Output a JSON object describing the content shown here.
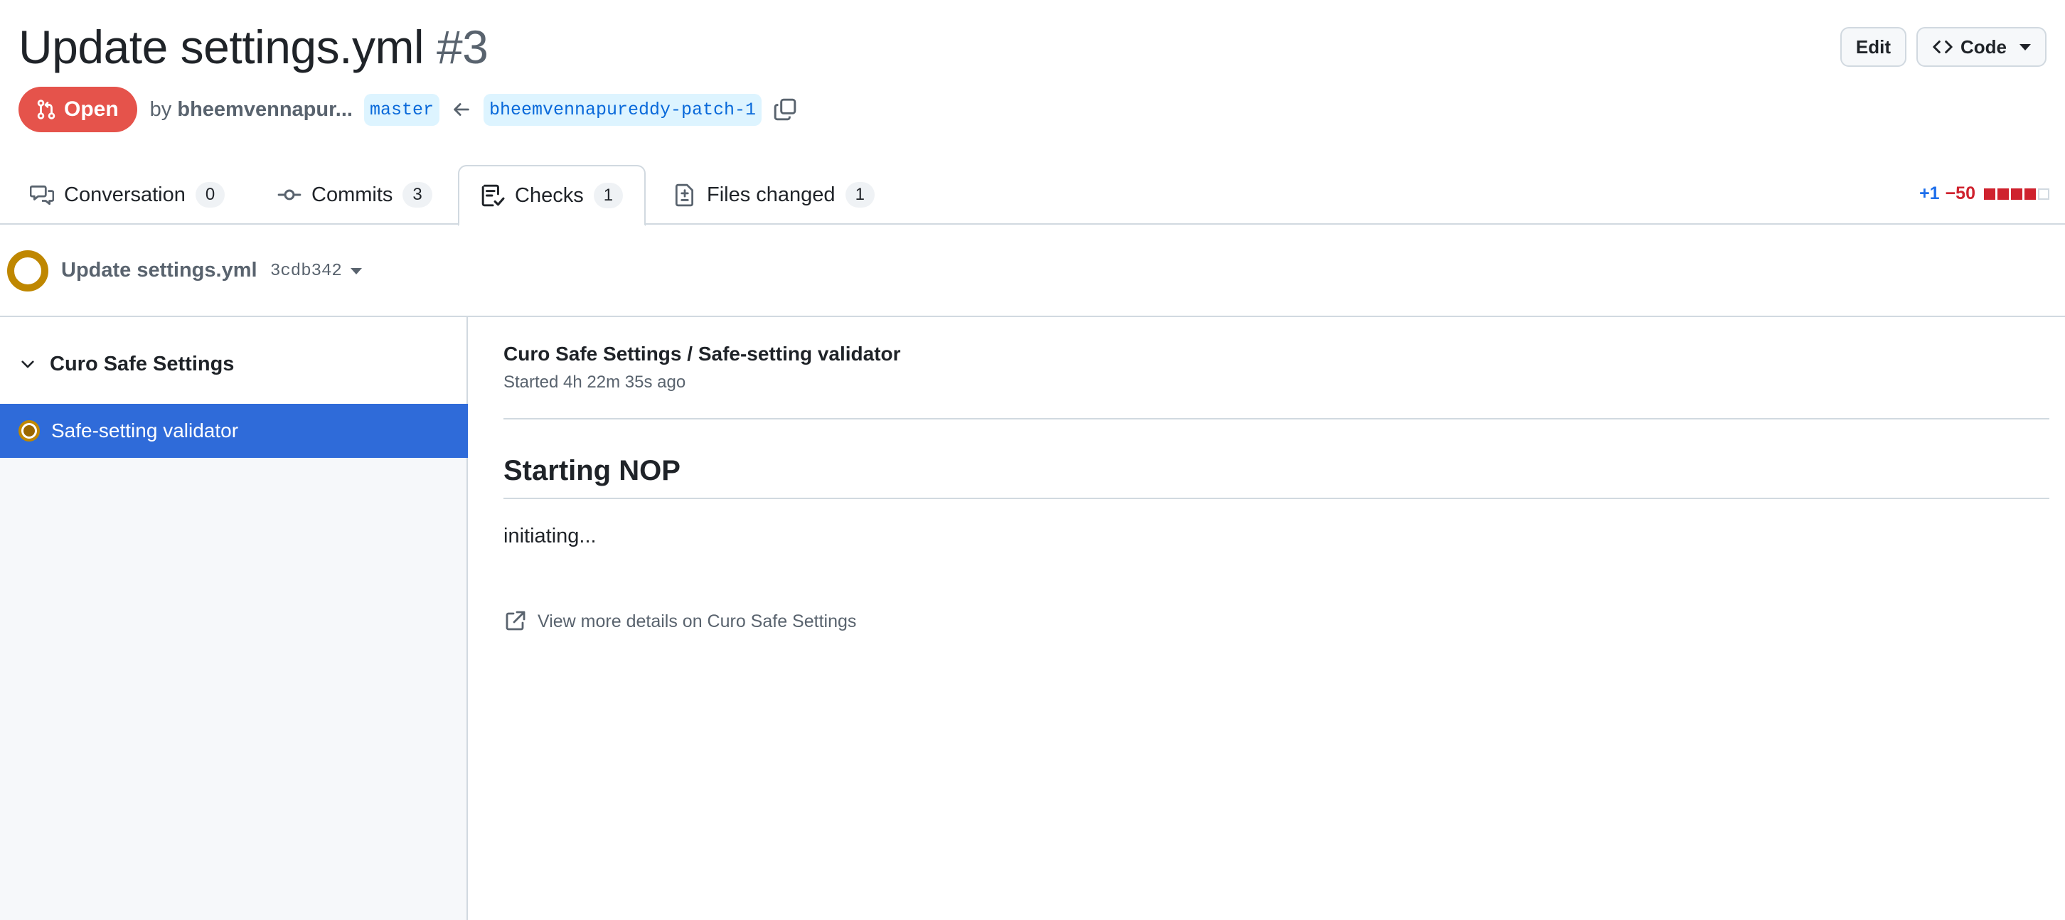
{
  "pr": {
    "title": "Update settings.yml",
    "number": "#3",
    "state": "Open",
    "by_prefix": "by",
    "author": "bheemvennapur...",
    "base_branch": "master",
    "head_branch": "bheemvennapureddy-patch-1"
  },
  "header_actions": {
    "edit_label": "Edit",
    "code_label": "Code"
  },
  "tabs": [
    {
      "label": "Conversation",
      "count": "0",
      "icon": "comment-discussion-icon"
    },
    {
      "label": "Commits",
      "count": "3",
      "icon": "git-commit-icon"
    },
    {
      "label": "Checks",
      "count": "1",
      "icon": "checklist-icon",
      "selected": true
    },
    {
      "label": "Files changed",
      "count": "1",
      "icon": "file-diff-icon"
    }
  ],
  "diffstat": {
    "additions": "+1",
    "deletions": "−50",
    "blocks": [
      "red",
      "red",
      "red",
      "red",
      "neutral"
    ]
  },
  "commit": {
    "message": "Update settings.yml",
    "sha": "3cdb342",
    "status": "pending"
  },
  "sidebar": {
    "suite_name": "Curo Safe Settings",
    "check_run": "Safe-setting validator"
  },
  "check_run_detail": {
    "title": "Curo Safe Settings / Safe-setting validator",
    "started": "Started 4h 22m 35s ago",
    "heading": "Starting NOP",
    "body": "initiating...",
    "details_link": "View more details on Curo Safe Settings"
  },
  "colors": {
    "open_badge": "#e5534b",
    "selected_run": "#2f6bd9",
    "pending": "#bf8700",
    "branch_bg": "#ddf4ff",
    "branch_fg": "#0969da"
  }
}
